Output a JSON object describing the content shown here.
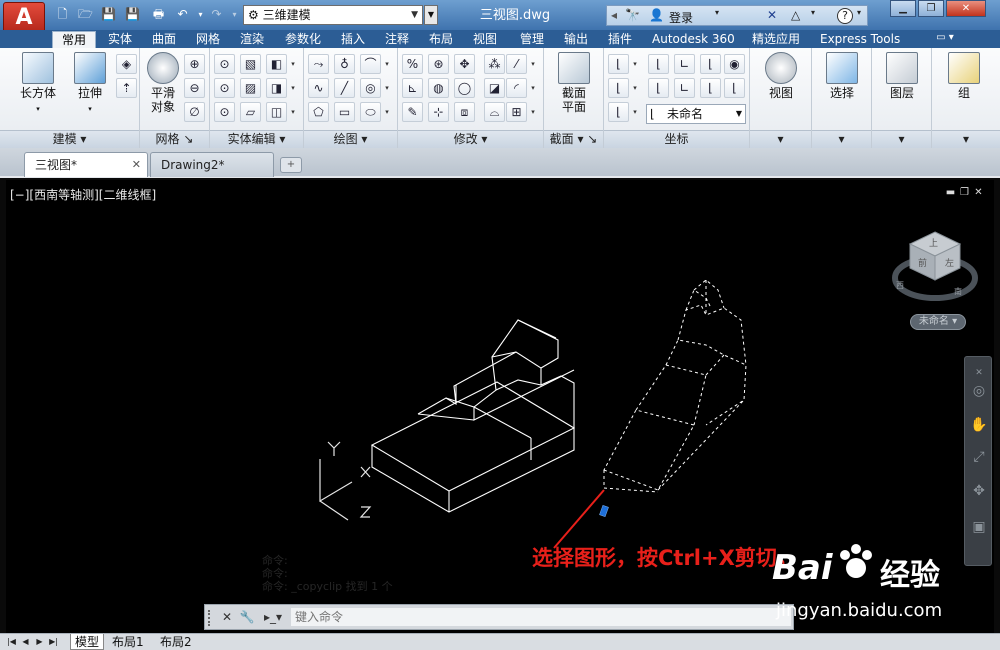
{
  "title_bar": {
    "app_logo": "A",
    "workspace": "三维建模",
    "document_title": "三视图.dwg",
    "login_label": "登录",
    "help_label": "?"
  },
  "ribbon_tabs": [
    "常用",
    "实体",
    "曲面",
    "网格",
    "渲染",
    "参数化",
    "插入",
    "注释",
    "布局",
    "视图",
    "管理",
    "输出",
    "插件",
    "Autodesk 360",
    "精选应用",
    "Express Tools"
  ],
  "ribbon": {
    "panels": {
      "modeling": "建模",
      "mesh": "网格",
      "solid_edit": "实体编辑",
      "draw": "绘图",
      "modify": "修改",
      "section": "截面",
      "coordinates": "坐标"
    },
    "buttons": {
      "box": "长方体",
      "extrude": "拉伸",
      "smooth_line1": "平滑",
      "smooth_line2": "对象",
      "section_line1": "截面",
      "section_line2": "平面",
      "view": "视图",
      "select": "选择",
      "layers": "图层",
      "groups": "组"
    },
    "ucs_combo": "未命名"
  },
  "file_tabs": [
    {
      "label": "三视图*",
      "active": true
    },
    {
      "label": "Drawing2*",
      "active": false
    }
  ],
  "viewport": {
    "label": "[−][西南等轴测][二维线框]",
    "viewcube_faces": {
      "top": "上",
      "front": "前",
      "left": "左",
      "south": "南",
      "west": "西"
    },
    "viewcube_label": "未命名"
  },
  "annotation_text": "选择图形，按Ctrl+X剪切。",
  "command_line": {
    "placeholder": "键入命令",
    "history": [
      "命令:",
      "命令:",
      "命令: _copyclip 找到 1 个"
    ]
  },
  "layout_tabs": [
    "模型",
    "布局1",
    "布局2"
  ],
  "watermark": {
    "brand": "Bai",
    "brand_cn": "经验",
    "url": "jingyan.baidu.com"
  },
  "colors": {
    "titlebar": "#4f82bf",
    "ribbon_tab_bar": "#2c5d95",
    "drawing_bg": "#000000",
    "annotation": "#e8201a",
    "grip": "#1e6fd9"
  }
}
